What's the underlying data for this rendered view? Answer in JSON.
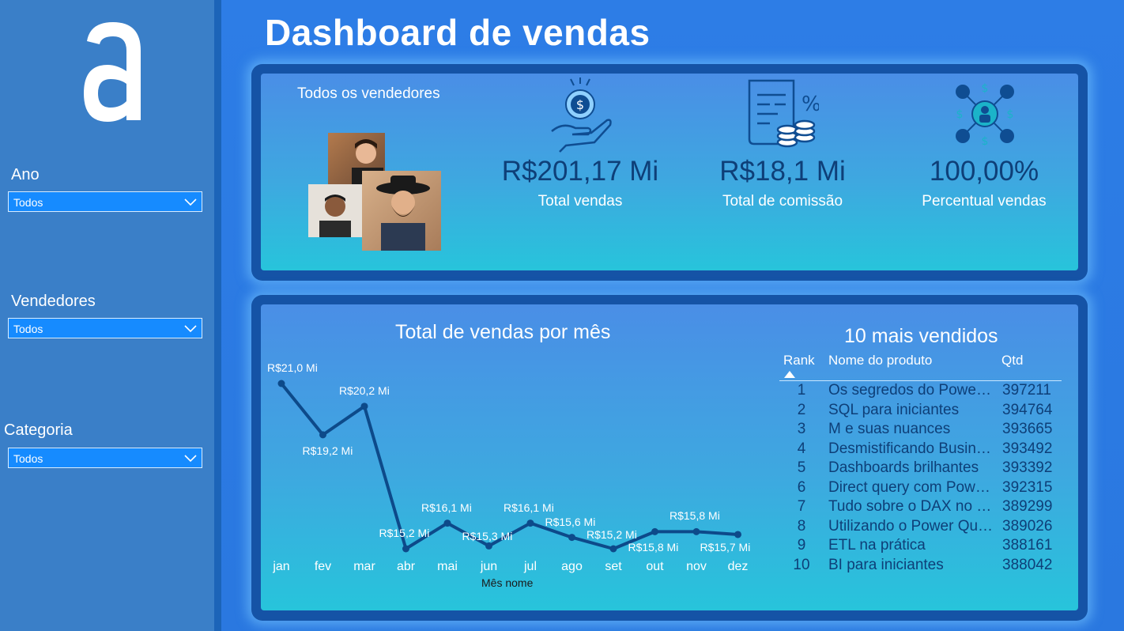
{
  "title": "Dashboard de vendas",
  "sidebar": {
    "logo_icon": "letter-a-logo",
    "filters": [
      {
        "label": "Ano",
        "value": "Todos"
      },
      {
        "label": "Vendedores",
        "value": "Todos"
      },
      {
        "label": "Categoria",
        "value": "Todos"
      }
    ]
  },
  "kpis": {
    "sellers_title": "Todos os vendedores",
    "cards": [
      {
        "icon": "money-hand-icon",
        "value": "R$201,17 Mi",
        "label": "Total vendas"
      },
      {
        "icon": "document-percent-coins-icon",
        "value": "R$18,1 Mi",
        "label": "Total de comissão"
      },
      {
        "icon": "network-dollar-people-icon",
        "value": "100,00%",
        "label": "Percentual vendas"
      }
    ]
  },
  "chart": {
    "title": "Total de vendas por mês",
    "xlabel": "Mês nome"
  },
  "chart_data": {
    "type": "line",
    "title": "Total de vendas por mês",
    "xlabel": "Mês nome",
    "ylabel": "",
    "categories": [
      "jan",
      "fev",
      "mar",
      "abr",
      "mai",
      "jun",
      "jul",
      "ago",
      "set",
      "out",
      "nov",
      "dez"
    ],
    "values": [
      21.0,
      19.2,
      20.2,
      15.2,
      16.1,
      15.3,
      16.1,
      15.6,
      15.2,
      15.8,
      15.8,
      15.7
    ],
    "labels": [
      "R$21,0 Mi",
      "R$19,2 Mi",
      "R$20,2 Mi",
      "R$15,2 Mi",
      "R$16,1 Mi",
      "R$15,3 Mi",
      "R$16,1 Mi",
      "R$15,6 Mi",
      "R$15,2 Mi",
      "R$15,8 Mi",
      "R$15,8 Mi",
      "R$15,7 Mi"
    ],
    "color": "#0d4a8a"
  },
  "top10": {
    "title": "10 mais vendidos",
    "columns": [
      "Rank",
      "Nome do produto",
      "Qtd"
    ],
    "rows": [
      {
        "rank": "1",
        "name": "Os segredos do Power BI",
        "qty": "397211"
      },
      {
        "rank": "2",
        "name": "SQL para iniciantes",
        "qty": "394764"
      },
      {
        "rank": "3",
        "name": "M e suas nuances",
        "qty": "393665"
      },
      {
        "rank": "4",
        "name": "Desmistificando Business Intelligence",
        "qty": "393492"
      },
      {
        "rank": "5",
        "name": "Dashboards brilhantes",
        "qty": "393392"
      },
      {
        "rank": "6",
        "name": "Direct query com Power BI",
        "qty": "392315"
      },
      {
        "rank": "7",
        "name": "Tudo sobre o DAX no Power BI",
        "qty": "389299"
      },
      {
        "rank": "8",
        "name": "Utilizando o Power Query",
        "qty": "389026"
      },
      {
        "rank": "9",
        "name": "ETL na prática",
        "qty": "388161"
      },
      {
        "rank": "10",
        "name": "BI para iniciantes",
        "qty": "388042"
      }
    ]
  },
  "colors": {
    "sidebar": "#3a7fc8",
    "accent_dark": "#0e3f78",
    "filter_bg": "#168bff"
  }
}
